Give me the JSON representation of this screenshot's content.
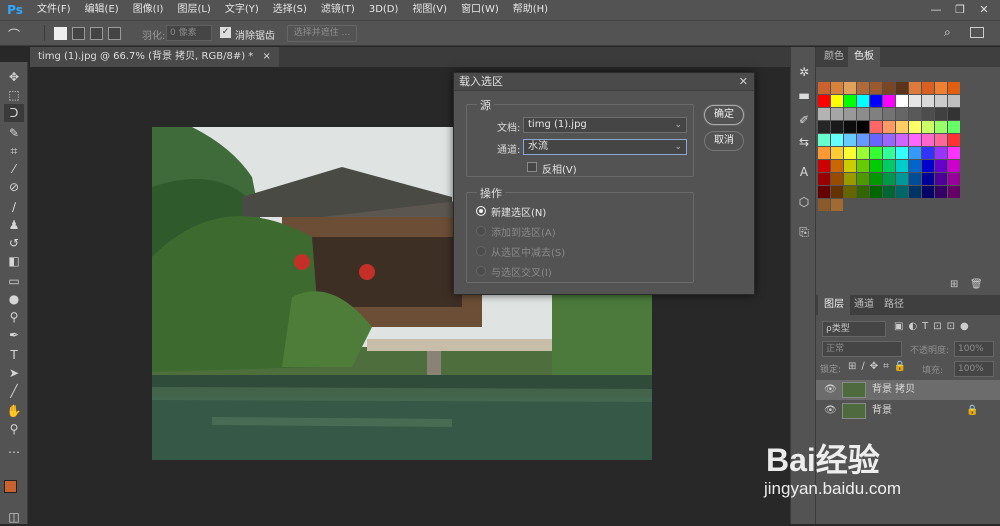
{
  "app": {
    "logo": "Ps"
  },
  "menu": [
    "文件(F)",
    "编辑(E)",
    "图像(I)",
    "图层(L)",
    "文字(Y)",
    "选择(S)",
    "滤镜(T)",
    "3D(D)",
    "视图(V)",
    "窗口(W)",
    "帮助(H)"
  ],
  "window_controls": {
    "minimize": "—",
    "restore": "❐",
    "close": "✕"
  },
  "options": {
    "feather_label": "羽化:",
    "feather_value": "0 像素",
    "antialias_label": "消除锯齿",
    "select_mask_button": "选择并遮住 ..."
  },
  "document": {
    "tab_title": "timg (1).jpg @ 66.7% (背景 拷贝, RGB/8#) *",
    "close": "×"
  },
  "dialog": {
    "title": "载入选区",
    "close": "✕",
    "source_group": "源",
    "document_label": "文档:",
    "document_value": "timg (1).jpg",
    "channel_label": "通道:",
    "channel_value": "水流",
    "invert_label": "反相(V)",
    "operation_group": "操作",
    "operations": [
      {
        "label": "新建选区(N)",
        "selected": true,
        "enabled": true
      },
      {
        "label": "添加到选区(A)",
        "selected": false,
        "enabled": false
      },
      {
        "label": "从选区中减去(S)",
        "selected": false,
        "enabled": false
      },
      {
        "label": "与选区交叉(I)",
        "selected": false,
        "enabled": false
      }
    ],
    "ok": "确定",
    "cancel": "取消"
  },
  "panels": {
    "color_tabs": [
      "颜色",
      "色板"
    ],
    "layer_tabs": [
      "图层",
      "通道",
      "路径"
    ],
    "filter_label": "ρ类型",
    "blend_mode": "正常",
    "opacity_label": "不透明度:",
    "opacity_value": "100%",
    "lock_label": "锁定:",
    "fill_label": "填充:",
    "fill_value": "100%",
    "layers": [
      {
        "name": "背景 拷贝",
        "selected": true,
        "locked": false
      },
      {
        "name": "背景",
        "selected": false,
        "locked": true
      }
    ]
  },
  "colors": {
    "foreground": "#c9622f",
    "background": "#ffffff",
    "accent": "#31a8ff"
  },
  "watermark": {
    "brand": "Bai经验",
    "url": "jingyan.baidu.com"
  }
}
